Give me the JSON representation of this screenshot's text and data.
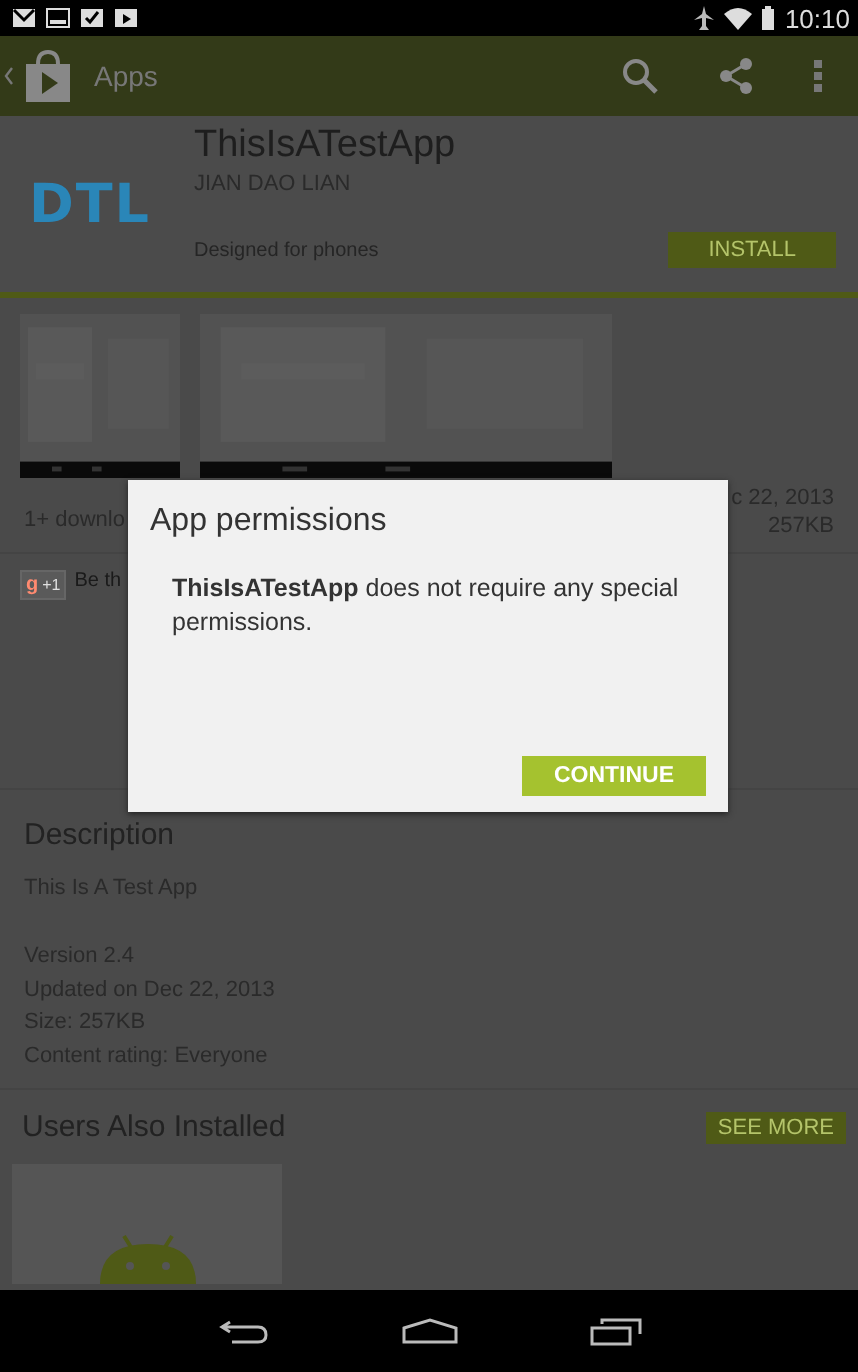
{
  "status_bar": {
    "time": "10:10"
  },
  "action_bar": {
    "title": "Apps"
  },
  "app": {
    "name": "ThisIsATestApp",
    "developer": "JIAN DAO LIAN",
    "logo": "DTL",
    "designed_for": "Designed for phones",
    "install_label": "INSTALL"
  },
  "info": {
    "downloads": "1+ downlo",
    "updated": "c 22, 2013",
    "size": "257KB"
  },
  "plus_one": {
    "letter": "g",
    "badge": "+1",
    "text": "Be th"
  },
  "description": {
    "heading": "Description",
    "body": "This Is A Test App",
    "details": [
      "Version 2.4",
      "Updated on Dec 22, 2013",
      "Size: 257KB",
      "Content rating: Everyone"
    ]
  },
  "also_installed": {
    "heading": "Users Also Installed",
    "see_more": "SEE MORE"
  },
  "dialog": {
    "title": "App permissions",
    "message": "**ThisIsATestApp** does not require any special permissions.",
    "button": "CONTINUE"
  }
}
